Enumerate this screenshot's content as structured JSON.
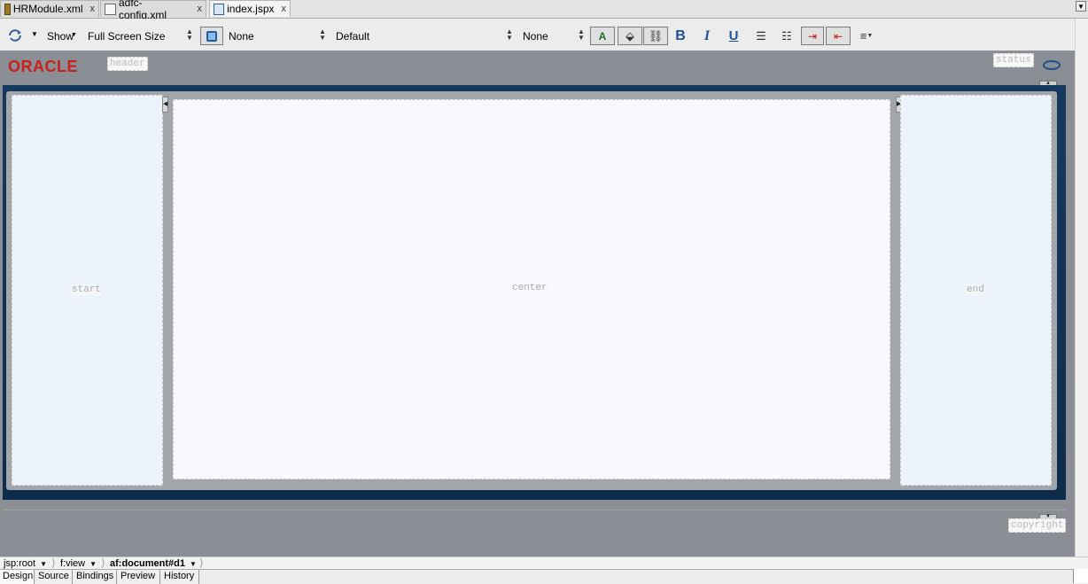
{
  "tabs": [
    {
      "label": "HRModule.xml",
      "icon": "module-icon",
      "close": "x"
    },
    {
      "label": "adfc-config.xml",
      "icon": "taskflow-icon",
      "close": "x"
    },
    {
      "label": "index.jspx",
      "icon": "jspx-page-icon",
      "close": "x"
    }
  ],
  "toolbar": {
    "show_label": "Show",
    "size_value": "Full Screen Size",
    "skin_value": "None",
    "style_value": "Default",
    "font_value": "None",
    "bold": "B",
    "italic": "I",
    "underline": "U"
  },
  "canvas": {
    "logo_text": "ORACLE",
    "facets": {
      "header": "header",
      "status": "status",
      "start": "start",
      "center": "center",
      "end": "end",
      "copyright": "copyright"
    },
    "colors": {
      "logo": "#c7211b",
      "band": "#163a5f",
      "background": "#8b8f95",
      "pane": "#edf3fb",
      "center_pane": "#f7f9fc"
    }
  },
  "breadcrumb": [
    "jsp:root",
    "f:view",
    "af:document#d1"
  ],
  "editor_tabs": [
    "Design",
    "Source",
    "Bindings",
    "Preview",
    "History"
  ]
}
